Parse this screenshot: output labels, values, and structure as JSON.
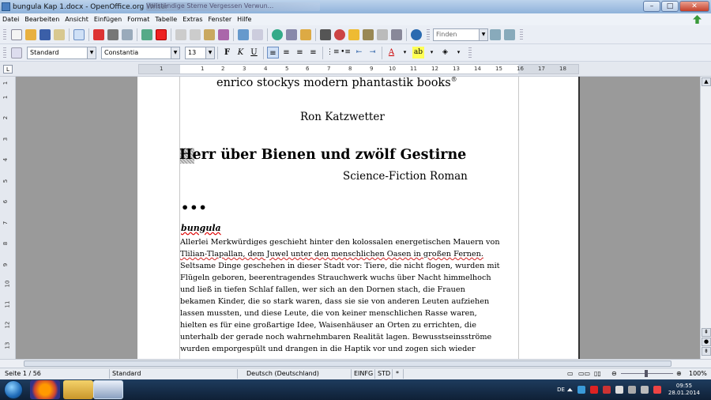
{
  "window": {
    "title": "bungula Kap 1.docx - OpenOffice.org Writer",
    "blurred_tab": "Vollständige Sterne Vergessen Verwun...",
    "buttons": {
      "minimize": "–",
      "maximize": "□",
      "close": "✕"
    }
  },
  "menu": {
    "items": [
      "Datei",
      "Bearbeiten",
      "Ansicht",
      "Einfügen",
      "Format",
      "Tabelle",
      "Extras",
      "Fenster",
      "Hilfe"
    ]
  },
  "toolbar": {
    "find_placeholder": "Finden"
  },
  "formatting": {
    "style": "Standard",
    "font": "Constantia",
    "size": "13",
    "bold": "F",
    "italic": "K",
    "underline": "U"
  },
  "ruler": {
    "ticks": [
      "1",
      "1",
      "2",
      "3",
      "4",
      "5",
      "6",
      "7",
      "8",
      "9",
      "10",
      "11",
      "12",
      "13",
      "14",
      "15",
      "16",
      "17",
      "18"
    ],
    "vticks": [
      "1",
      "1",
      "2",
      "3",
      "4",
      "5",
      "6",
      "7",
      "8",
      "9",
      "10",
      "11",
      "12",
      "13"
    ],
    "corner": "L"
  },
  "document": {
    "publisher": "enrico stockys modern phantastik books",
    "publisher_mark": "®",
    "author": "Ron Katzwetter",
    "title": "Herr über Bienen und zwölf Gestirne",
    "subtitle": "Science-Fiction Roman",
    "separator": "•••",
    "section_heading": "bungula",
    "body_lines": [
      "Allerlei Merkwürdiges geschieht hinter den kolossalen energetischen Mauern von",
      "Tlilian-Tlapallan, dem Juwel unter den menschlichen Oasen in großen Fernen.",
      "Seltsame Dinge geschehen in dieser Stadt vor: Tiere, die nicht flogen, wurden mit",
      "Flügeln geboren, beerentragendes Strauchwerk wuchs über Nacht himmelhoch",
      "und ließ in tiefen Schlaf fallen, wer sich an den Dornen stach, die Frauen",
      "bekamen Kinder, die so stark waren, dass sie sie von anderen Leuten aufziehen",
      "lassen mussten, und diese Leute, die von keiner menschlichen Rasse waren,",
      "hielten es für eine großartige Idee, Waisenhäuser an Orten zu errichten, die",
      "unterhalb der gerade noch wahrnehmbaren Realität lagen. Bewusstseinsströme",
      "wurden emporgespült und drangen in die Haptik vor und zogen sich wieder"
    ]
  },
  "status": {
    "page": "Seite 1 / 56",
    "style": "Standard",
    "language": "Deutsch (Deutschland)",
    "insert_mode": "EINFG",
    "selection_mode": "STD",
    "modified": "*",
    "zoom": "100%"
  },
  "taskbar": {
    "time": "09:55",
    "date": "28.01.2014",
    "lang": "DE"
  },
  "colors": {
    "accent": "#1f6bb8",
    "spell_error": "#d02020"
  }
}
